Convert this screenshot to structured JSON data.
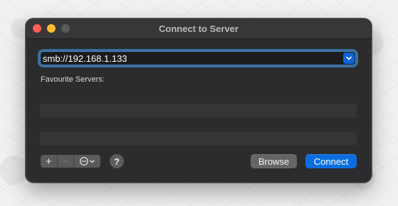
{
  "window": {
    "title": "Connect to Server"
  },
  "address": {
    "value": "smb://192.168.1.133"
  },
  "favourites": {
    "label": "Favourite Servers:",
    "items": []
  },
  "toolbar": {
    "add_label": "+",
    "remove_label": "−",
    "more_label": "⊙⌄",
    "help_label": "?"
  },
  "actions": {
    "browse_label": "Browse",
    "connect_label": "Connect"
  },
  "icons": {
    "dropdown": "chevron-down-icon",
    "add": "plus-icon",
    "remove": "minus-icon",
    "more": "ellipsis-circle-icon",
    "help": "question-icon"
  },
  "colors": {
    "accent": "#0b6ee0",
    "close": "#fe5f57",
    "minimize": "#febc2e"
  }
}
